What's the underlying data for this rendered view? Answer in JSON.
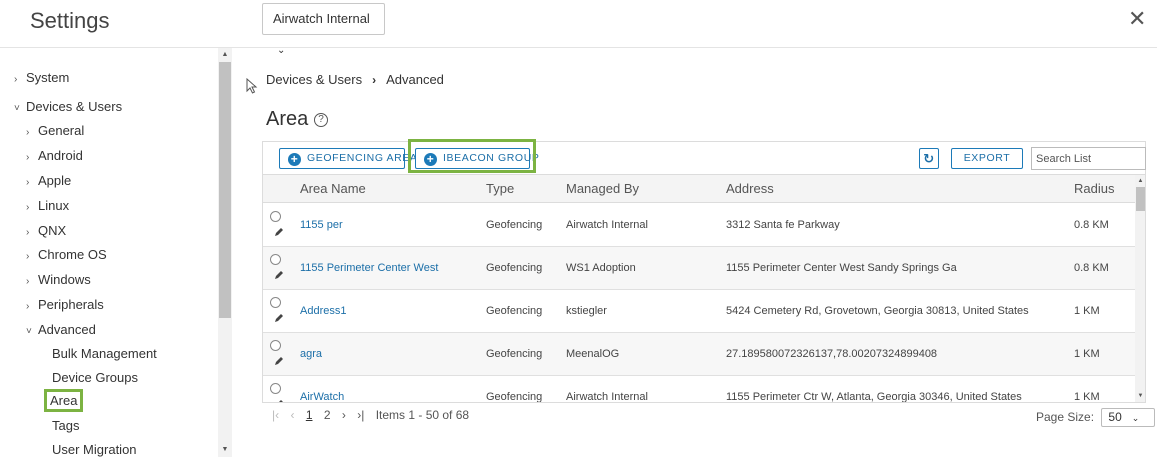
{
  "header": {
    "title": "Settings",
    "org_select": "Airwatch Internal",
    "close_icon": "close-icon"
  },
  "sidebar": {
    "items": [
      {
        "label": "System",
        "caret": "›"
      },
      {
        "label": "Devices & Users",
        "caret": "˅"
      },
      {
        "label": "General",
        "caret": "›"
      },
      {
        "label": "Android",
        "caret": "›"
      },
      {
        "label": "Apple",
        "caret": "›"
      },
      {
        "label": "Linux",
        "caret": "›"
      },
      {
        "label": "QNX",
        "caret": "›"
      },
      {
        "label": "Chrome OS",
        "caret": "›"
      },
      {
        "label": "Windows",
        "caret": "›"
      },
      {
        "label": "Peripherals",
        "caret": "›"
      },
      {
        "label": "Advanced",
        "caret": "˅"
      },
      {
        "label": "Bulk Management"
      },
      {
        "label": "Device Groups"
      },
      {
        "label": "Area"
      },
      {
        "label": "Tags"
      },
      {
        "label": "User Migration"
      }
    ],
    "active": "Area"
  },
  "breadcrumb": {
    "parent": "Devices & Users",
    "separator": "›",
    "current": "Advanced"
  },
  "page": {
    "title": "Area",
    "help_icon": "?"
  },
  "toolbar": {
    "geofencing_label": "GEOFENCING AREA",
    "ibeacon_label": "IBEACON GROUP",
    "refresh_icon": "↻",
    "export_label": "EXPORT",
    "search_placeholder": "Search List"
  },
  "table": {
    "columns": [
      "Area Name",
      "Type",
      "Managed By",
      "Address",
      "Radius"
    ],
    "rows": [
      {
        "name": "1155 per",
        "type": "Geofencing",
        "managed_by": "Airwatch Internal",
        "address": "3312 Santa fe Parkway",
        "radius": "0.8 KM"
      },
      {
        "name": "1155 Perimeter Center West",
        "type": "Geofencing",
        "managed_by": "WS1 Adoption",
        "address": "1155 Perimeter Center West Sandy Springs Ga",
        "radius": "0.8 KM"
      },
      {
        "name": "Address1",
        "type": "Geofencing",
        "managed_by": "kstiegler",
        "address": "5424 Cemetery Rd, Grovetown, Georgia 30813, United States",
        "radius": "1 KM"
      },
      {
        "name": "agra",
        "type": "Geofencing",
        "managed_by": "MeenalOG",
        "address": "27.189580072326137,78.00207324899408",
        "radius": "1 KM"
      },
      {
        "name": "AirWatch",
        "type": "Geofencing",
        "managed_by": "Airwatch Internal",
        "address": "1155 Perimeter Ctr W, Atlanta, Georgia 30346, United States",
        "radius": "1 KM"
      }
    ]
  },
  "pager": {
    "first": "|‹",
    "prev": "‹",
    "page1": "1",
    "page2": "2",
    "next": "›",
    "last": "›|",
    "items_text": "Items 1 - 50 of 68",
    "page_size_label": "Page Size:",
    "page_size_value": "50"
  },
  "colors": {
    "accent": "#1c7ab8",
    "highlight": "#7cb342"
  }
}
